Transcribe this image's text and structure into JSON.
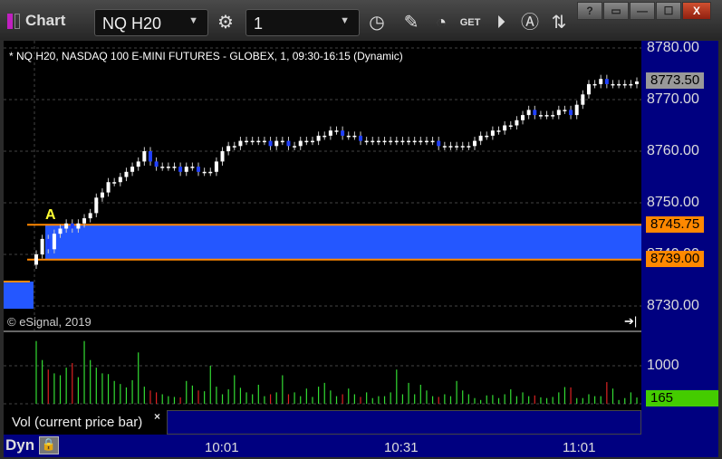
{
  "window": {
    "title": "Chart",
    "symbol": "NQ H20",
    "interval": "1",
    "buttons": [
      "?",
      "▭",
      "—",
      "☐",
      "X"
    ]
  },
  "toolbar_icons": [
    "settings-icon",
    "clock-icon",
    "pencil-icon",
    "study-icon",
    "get-icon",
    "play-icon",
    "alert-icon",
    "link-arrows-icon"
  ],
  "chart": {
    "header": "* NQ H20, NASDAQ 100 E-MINI FUTURES - GLOBEX, 1, 09:30-16:15 (Dynamic)",
    "copyright": "© eSignal, 2019",
    "marker": "A",
    "price_ticks": [
      "8780.00",
      "8770.00",
      "8760.00",
      "8750.00",
      "8740.00",
      "8730.00"
    ],
    "last_price": "8773.50",
    "upper_level": "8745.75",
    "lower_level": "8739.00",
    "colors": {
      "up": "#ffffff",
      "down": "#2040ff",
      "zone": "#2457ff",
      "level": "#ff8800",
      "vol_up": "#33dd33",
      "vol_down": "#dd2222"
    },
    "closes": [
      8740,
      8743,
      8741,
      8744,
      8745,
      8746,
      8745,
      8746,
      8747,
      8748,
      8751,
      8752,
      8754,
      8754,
      8755,
      8756,
      8757,
      8758,
      8760,
      8758,
      8757,
      8757,
      8757,
      8757,
      8756,
      8757,
      8757,
      8756,
      8756,
      8756,
      8758,
      8760,
      8761,
      8761,
      8762,
      8762,
      8762,
      8762,
      8762,
      8761,
      8762,
      8762,
      8761,
      8761,
      8762,
      8762,
      8762,
      8763,
      8763,
      8764,
      8764,
      8763,
      8763,
      8763,
      8762,
      8762,
      8762,
      8762,
      8762,
      8762,
      8762,
      8762,
      8762,
      8762,
      8762,
      8762,
      8762,
      8761,
      8761,
      8761,
      8761,
      8761,
      8761,
      8762,
      8763,
      8763,
      8764,
      8764,
      8765,
      8765,
      8766,
      8767,
      8768,
      8767,
      8767,
      8767,
      8767,
      8768,
      8768,
      8767,
      8769,
      8771,
      8773,
      8773,
      8774,
      8773,
      8773,
      8773,
      8773,
      8773,
      8773.5
    ]
  },
  "volume": {
    "label": "Vol (current price bar)",
    "close": "×",
    "tick": "1000",
    "current": "165",
    "current_color": "#44cc00",
    "values": [
      1650,
      1150,
      900,
      800,
      750,
      950,
      1070,
      700,
      1650,
      1150,
      950,
      800,
      780,
      600,
      520,
      430,
      620,
      1350,
      450,
      350,
      300,
      250,
      200,
      180,
      170,
      600,
      480,
      350,
      330,
      1000,
      450,
      250,
      380,
      750,
      420,
      300,
      250,
      500,
      200,
      250,
      300,
      750,
      250,
      300,
      200,
      400,
      180,
      450,
      550,
      350,
      200,
      250,
      400,
      250,
      180,
      300,
      150,
      200,
      200,
      300,
      900,
      250,
      550,
      250,
      500,
      350,
      200,
      180,
      250,
      200,
      600,
      350,
      250,
      150,
      100,
      220,
      230,
      150,
      250,
      380,
      200,
      300,
      200,
      220,
      170,
      150,
      180,
      300,
      440,
      430,
      150,
      150,
      250,
      200,
      200,
      570,
      400,
      100,
      150,
      300,
      165
    ]
  },
  "time_axis": {
    "labels": [
      "10:01",
      "10:31",
      "11:01"
    ],
    "left_label": "Dyn"
  }
}
